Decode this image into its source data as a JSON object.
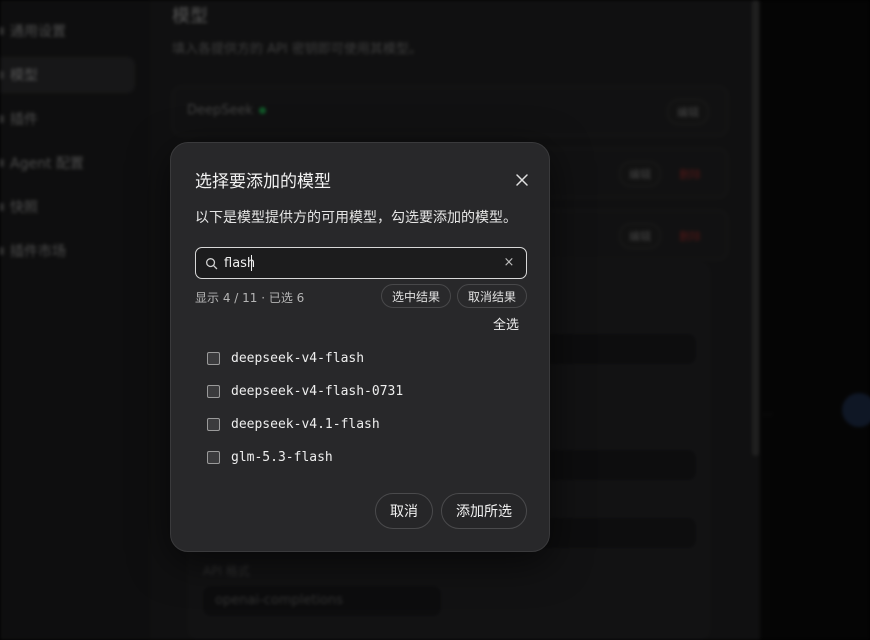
{
  "background": {
    "sidebar": {
      "items": [
        {
          "label": "通用设置",
          "active": false
        },
        {
          "label": "模型",
          "active": true
        },
        {
          "label": "插件",
          "active": false
        },
        {
          "label": "Agent 配置",
          "active": false
        },
        {
          "label": "快照",
          "active": false
        },
        {
          "label": "插件市场",
          "active": false
        }
      ]
    },
    "main": {
      "title": "模型",
      "description": "填入各提供方的 API 密钥即可使用其模型。",
      "providers": [
        {
          "name": "DeepSeek",
          "edit_label": "编辑"
        },
        {
          "edit_label": "编辑",
          "delete_label": "删除"
        },
        {
          "edit_label": "编辑",
          "delete_label": "删除"
        }
      ],
      "api_format_label": "API 格式",
      "api_format_value": "openai-completions"
    },
    "right_pane": {
      "text": "..."
    }
  },
  "modal": {
    "title": "选择要添加的模型",
    "description": "以下是模型提供方的可用模型，勾选要添加的模型。",
    "search": {
      "value": "flash",
      "clear_label": "×"
    },
    "count_text": "显示 4 / 11 · 已选 6",
    "select_results_label": "选中结果",
    "deselect_results_label": "取消结果",
    "select_all_label": "全选",
    "models": [
      {
        "name": "deepseek-v4-flash",
        "checked": false
      },
      {
        "name": "deepseek-v4-flash-0731",
        "checked": false
      },
      {
        "name": "deepseek-v4.1-flash",
        "checked": false
      },
      {
        "name": "glm-5.3-flash",
        "checked": false
      }
    ],
    "cancel_label": "取消",
    "add_label": "添加所选"
  }
}
